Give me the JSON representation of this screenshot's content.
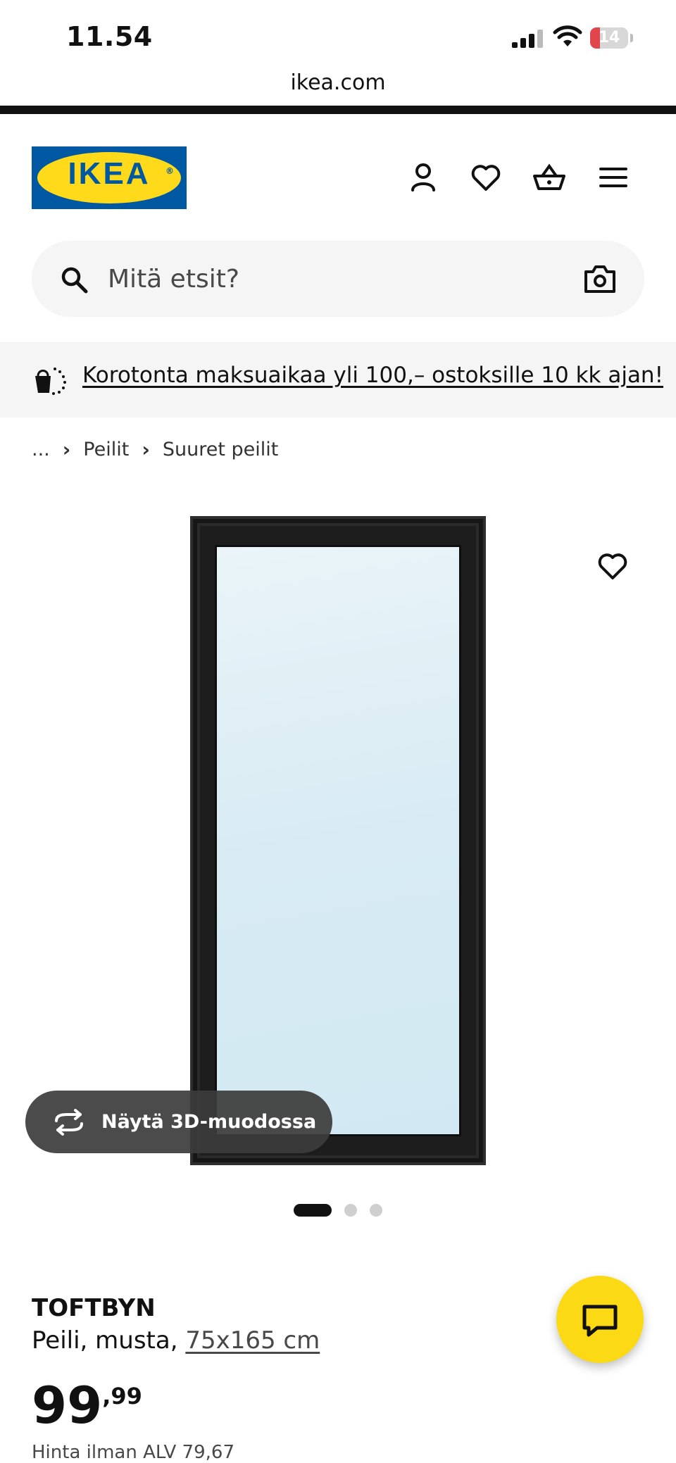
{
  "status": {
    "time": "11.54",
    "battery": "14"
  },
  "browser": {
    "url": "ikea.com"
  },
  "header": {
    "logo": "IKEA",
    "icons": [
      "account-icon",
      "wishlist-heart-icon",
      "shopping-basket-icon",
      "hamburger-menu-icon"
    ]
  },
  "search": {
    "placeholder": "Mitä etsit?"
  },
  "promo": {
    "text": "Korotonta maksuaikaa yli 100,– ostoksille 10 kk ajan!"
  },
  "breadcrumb": {
    "ellipsis": "...",
    "items": [
      "Peilit",
      "Suuret peilit"
    ]
  },
  "gallery": {
    "view3d_label": "Näytä 3D-muodossa",
    "slide_count": 3,
    "active_slide": 1
  },
  "product": {
    "name": "TOFTBYN",
    "description": "Peili, musta,",
    "size": "75x165 cm",
    "price_main": "99",
    "price_cents": ",99",
    "vat_text": "Hinta ilman ALV 79,67"
  },
  "colors": {
    "ikea_blue": "#0058a3",
    "ikea_yellow": "#ffda1a",
    "chat_button": "#fbd914"
  }
}
